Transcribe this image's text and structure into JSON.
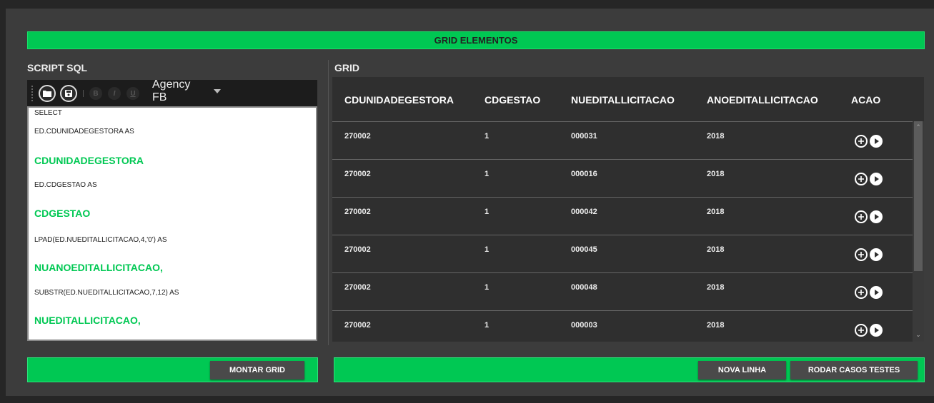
{
  "title": "GRID ELEMENTOS",
  "sql_panel": {
    "label": "SCRIPT SQL",
    "font_name": "Agency FB",
    "format_buttons": [
      "B",
      "I",
      "U"
    ],
    "lines": [
      {
        "text": "SELECT",
        "style": "normal"
      },
      {
        "text": "ED.CDUNIDADEGESTORA AS",
        "style": "normal"
      },
      {
        "text": "CDUNIDADEGESTORA",
        "style": "big"
      },
      {
        "text": "ED.CDGESTAO AS",
        "style": "normal"
      },
      {
        "text": "CDGESTAO",
        "style": "big"
      },
      {
        "text": "LPAD(ED.NUEDITALLICITACAO,4,'0') AS",
        "style": "normal"
      },
      {
        "text": "NUANOEDITALLICITACAO,",
        "style": "big"
      },
      {
        "text": "SUBSTR(ED.NUEDITALLICITACAO,7,12) AS",
        "style": "normal"
      },
      {
        "text": "NUEDITALLICITACAO,",
        "style": "big"
      }
    ],
    "montar_button": "MONTAR GRID"
  },
  "grid_panel": {
    "label": "GRID",
    "columns": [
      "CDUNIDADEGESTORA",
      "CDGESTAO",
      "NUEDITALLICITACAO",
      "ANOEDITALLICITACAO",
      "ACAO"
    ],
    "rows": [
      [
        "270002",
        "1",
        "000031",
        "2018"
      ],
      [
        "270002",
        "1",
        "000016",
        "2018"
      ],
      [
        "270002",
        "1",
        "000042",
        "2018"
      ],
      [
        "270002",
        "1",
        "000045",
        "2018"
      ],
      [
        "270002",
        "1",
        "000048",
        "2018"
      ],
      [
        "270002",
        "1",
        "000003",
        "2018"
      ]
    ],
    "nova_linha_button": "NOVA LINHA",
    "rodar_button": "RODAR CASOS TESTES"
  },
  "colors": {
    "accent_green": "#00c853",
    "panel_bg": "#3c3c3c",
    "grid_bg": "#2f2f2f"
  }
}
